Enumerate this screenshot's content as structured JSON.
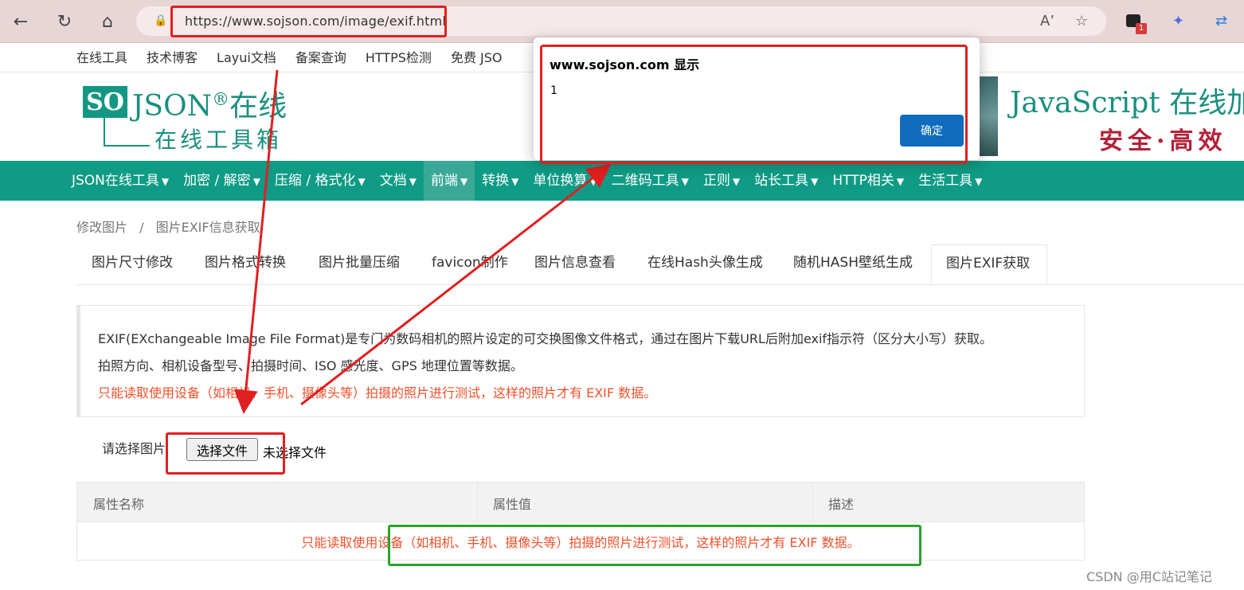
{
  "browser": {
    "url": "https://www.sojson.com/image/exif.html",
    "notification_count": "1",
    "icons": [
      "back-icon",
      "refresh-icon",
      "home-icon",
      "lock-icon",
      "read-aloud-icon",
      "favorite-icon",
      "extension-icon",
      "copilot-icon",
      "sync-icon"
    ]
  },
  "top_links": [
    "在线工具",
    "技术博客",
    "Layui文档",
    "备案查询",
    "HTTPS检测",
    "免费 JSO"
  ],
  "logo": {
    "so": "SO",
    "json": "JSON",
    "reg": "®",
    "zaixian": "在线",
    "sub": "在线工具箱"
  },
  "banner": {
    "line1": "JavaScript 在线加",
    "line2": "安全·高效"
  },
  "main_nav": [
    {
      "label": "JSON在线工具",
      "active": false
    },
    {
      "label": "加密 / 解密",
      "active": false
    },
    {
      "label": "压缩 / 格式化",
      "active": false
    },
    {
      "label": "文档",
      "active": false
    },
    {
      "label": "前端",
      "active": true
    },
    {
      "label": "转换",
      "active": false
    },
    {
      "label": "单位换算",
      "active": false
    },
    {
      "label": "二维码工具",
      "active": false
    },
    {
      "label": "正则",
      "active": false
    },
    {
      "label": "站长工具",
      "active": false
    },
    {
      "label": "HTTP相关",
      "active": false
    },
    {
      "label": "生活工具",
      "active": false
    }
  ],
  "breadcrumb": {
    "parent": "修改图片",
    "separator": "/",
    "current": "图片EXIF信息获取"
  },
  "tabs": [
    "图片尺寸修改",
    "图片格式转换",
    "图片批量压缩",
    "favicon制作",
    "图片信息查看",
    "在线Hash头像生成",
    "随机HASH壁纸生成",
    "图片EXIF获取"
  ],
  "info": {
    "line1": "EXIF(EXchangeable Image File Format)是专门为数码相机的照片设定的可交换图像文件格式，通过在图片下载URL后附加exif指示符（区分大小写）获取。",
    "line2": "拍照方向、相机设备型号、拍摄时间、ISO 感光度、GPS 地理位置等数据。",
    "warning": "只能读取使用设备（如相机、手机、摄像头等）拍摄的照片进行测试，这样的照片才有 EXIF 数据。"
  },
  "file_select": {
    "label": "请选择图片",
    "button": "选择文件",
    "status": "未选择文件"
  },
  "table": {
    "headers": [
      "属性名称",
      "属性值",
      "描述"
    ],
    "empty_message": "只能读取使用设备（如相机、手机、摄像头等）拍摄的照片进行测试，这样的照片才有 EXIF 数据。"
  },
  "dialog": {
    "title": "www.sojson.com 显示",
    "message": "1",
    "ok": "确定"
  },
  "watermark": "CSDN @用C站记笔记",
  "colors": {
    "brand_green": "#0f9b85",
    "annotation_red": "#e02020",
    "annotation_green": "#29a329",
    "warning_text": "#f0502b",
    "dialog_button": "#0f6cbd"
  }
}
